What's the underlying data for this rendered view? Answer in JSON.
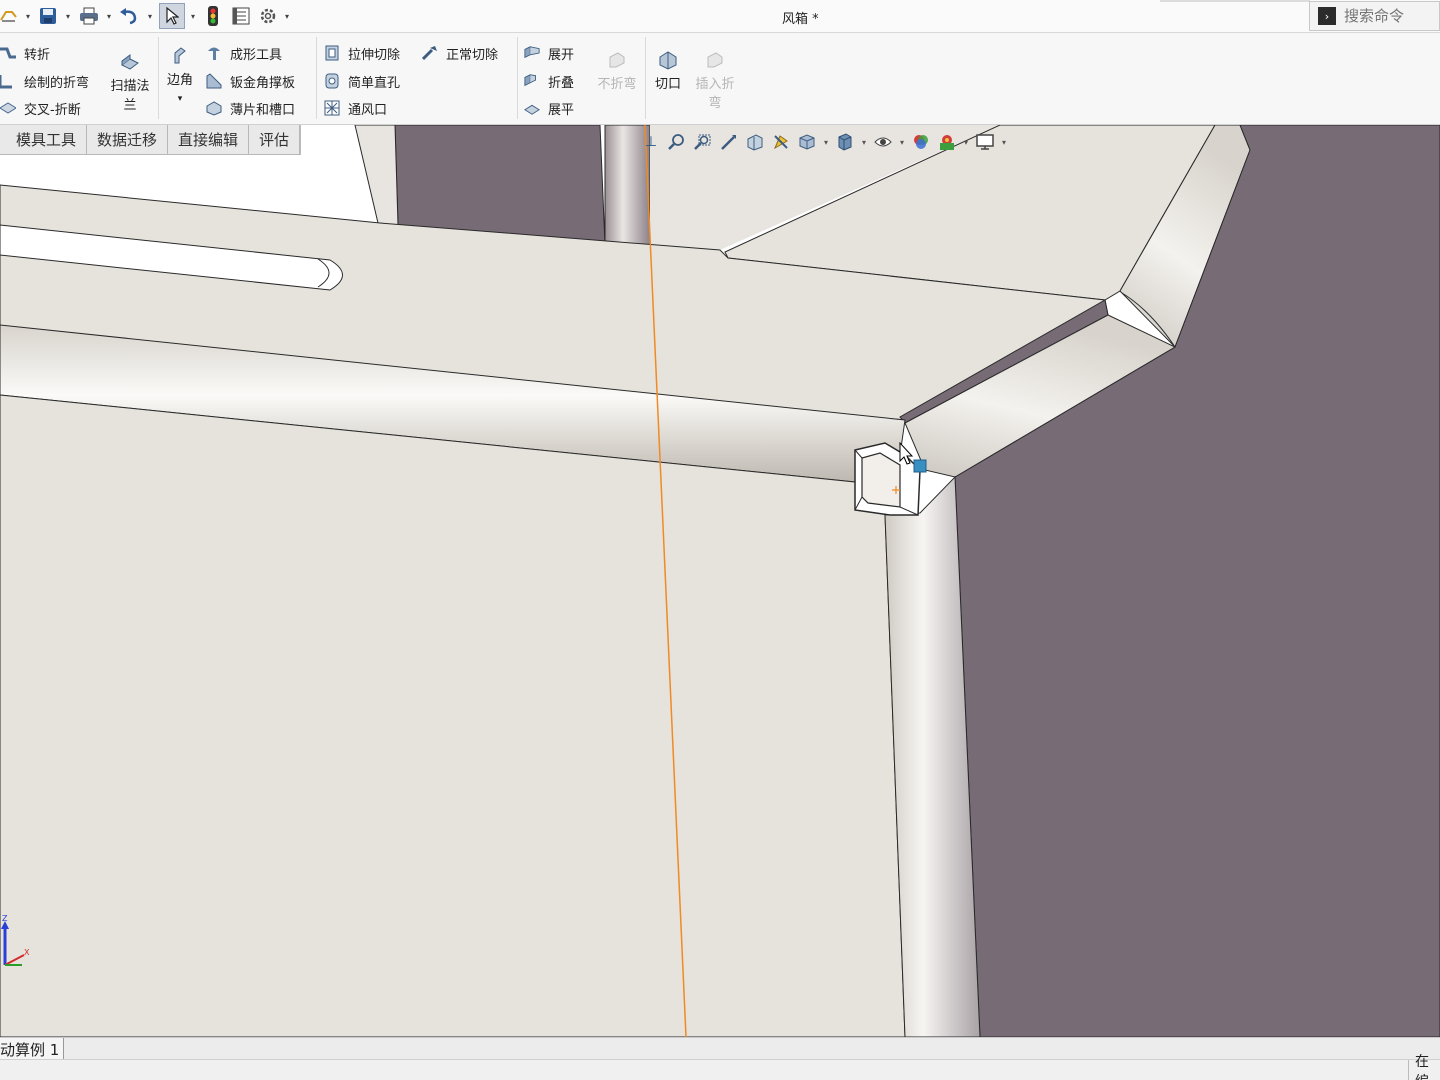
{
  "window": {
    "title": "风箱 *"
  },
  "quick_access": {
    "icons": [
      "new-file-icon",
      "save-icon",
      "print-icon",
      "undo-icon",
      "select-arrow-icon",
      "rebuild-icon",
      "file-properties-icon",
      "options-gear-icon"
    ]
  },
  "search": {
    "placeholder": "搜索命令"
  },
  "ribbon": {
    "group1": {
      "jog": "转折",
      "sketched_bend": "绘制的折弯",
      "cross_break": "交叉-折断"
    },
    "swept_flange": {
      "line1": "扫描法",
      "line2": "兰"
    },
    "corners": {
      "label": "边角",
      "arrow": "▾"
    },
    "group3": {
      "forming_tool": "成形工具",
      "gusset": "钣金角撑板",
      "tab_slot": "薄片和槽口"
    },
    "group4": {
      "extruded_cut": "拉伸切除",
      "simple_hole": "简单直孔",
      "vent": "通风口"
    },
    "normal_cut": "正常切除",
    "group5": {
      "unfold": "展开",
      "fold": "折叠",
      "flatten": "展平"
    },
    "no_bends": "不折弯",
    "rip": "切口",
    "insert_bends": {
      "line1": "插入折",
      "line2": "弯"
    }
  },
  "command_tabs": [
    "模具工具",
    "数据迁移",
    "直接编辑",
    "评估"
  ],
  "bottom_tab": "动算例 1",
  "status": {
    "right_text": "在编"
  },
  "colors": {
    "sheet_face": "#e8e5e0",
    "dark_face": "#776b76",
    "edge": "#2a2a2a",
    "sketch_line": "#f08a24",
    "selection_marker": "#3a8fc2"
  }
}
